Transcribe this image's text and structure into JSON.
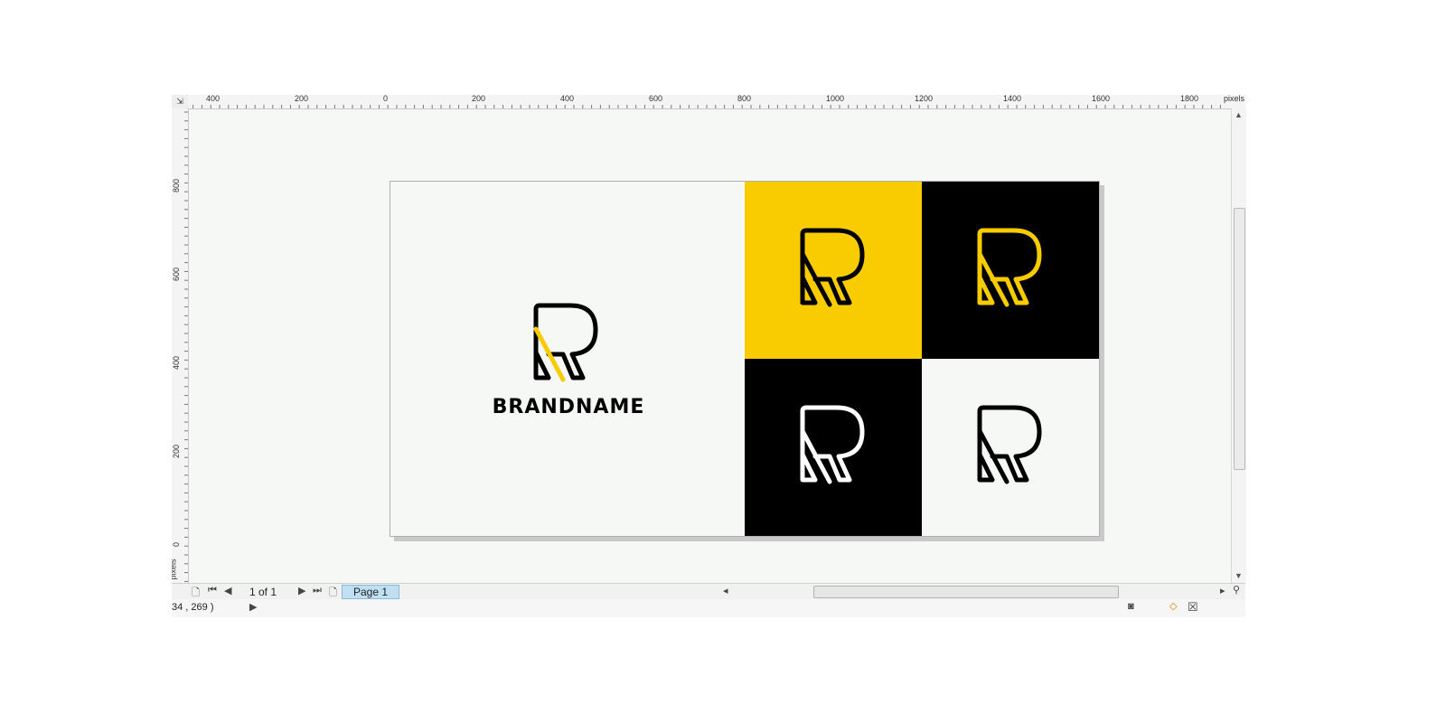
{
  "ruler": {
    "unit": "pixels",
    "top_labels": [
      "400",
      "200",
      "0",
      "200",
      "400",
      "600",
      "800",
      "1000",
      "1200",
      "1400",
      "1600",
      "1800"
    ],
    "left_labels": [
      "800",
      "600",
      "400",
      "200",
      "0"
    ]
  },
  "document": {
    "brand_name": "BRANDNAME",
    "colors": {
      "yellow": "#f8cc00",
      "black": "#000000",
      "white": "#f6f8f6"
    },
    "tiles": [
      {
        "bg": "yellow",
        "mark": "black"
      },
      {
        "bg": "black",
        "mark": "yellow"
      },
      {
        "bg": "black",
        "mark": "white"
      },
      {
        "bg": "white",
        "mark": "black"
      }
    ]
  },
  "navigator": {
    "page_count": "1 of 1",
    "page_tab": "Page 1",
    "icons": [
      "add-page-icon",
      "first-page-icon",
      "prev-page-icon",
      "next-page-icon",
      "last-page-icon",
      "add-page-after-icon",
      "zoom-icon"
    ]
  },
  "status": {
    "cursor_position": "34 , 269  )",
    "icons": [
      "play-icon",
      "snapshot-icon",
      "fill-icon",
      "no-outline-icon"
    ]
  }
}
